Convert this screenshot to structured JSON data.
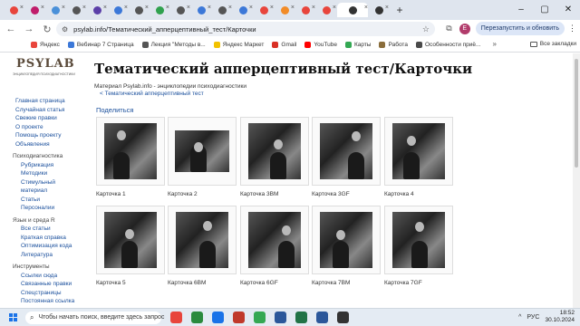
{
  "browser": {
    "tabs": [
      {
        "color": "#e8453c"
      },
      {
        "color": "#c01d6b"
      },
      {
        "color": "#4a90d9"
      },
      {
        "color": "#555555"
      },
      {
        "color": "#5b3fa8"
      },
      {
        "color": "#3c78d8"
      },
      {
        "color": "#555555"
      },
      {
        "color": "#30a14e"
      },
      {
        "color": "#555555"
      },
      {
        "color": "#3c78d8"
      },
      {
        "color": "#555555"
      },
      {
        "color": "#3c78d8"
      },
      {
        "color": "#e8453c"
      },
      {
        "color": "#f28c28"
      },
      {
        "color": "#e8453c"
      },
      {
        "color": "#e8453c"
      },
      {
        "color": "#333333",
        "active": true
      },
      {
        "color": "#333333"
      }
    ],
    "new_tab_glyph": "+",
    "window_controls": [
      "–",
      "▢",
      "✕"
    ],
    "nav": {
      "back": "←",
      "forward": "→",
      "reload": "↻"
    },
    "url": "psylab.info/Тематический_апперцептивный_тест/Карточки",
    "star_glyph": "☆",
    "avatar_letter": "E",
    "update_label": "Перезапустить и обновить",
    "menu_glyph": "⋮"
  },
  "bookmarks": {
    "items": [
      {
        "label": "Яндекс",
        "color": "#e8453c"
      },
      {
        "label": "Вебинар 7 Страница",
        "color": "#3c78d8"
      },
      {
        "label": "Лекция \"Методы в...",
        "color": "#555555"
      },
      {
        "label": "Яндекс Маркет",
        "color": "#f2c200"
      },
      {
        "label": "Gmail",
        "color": "#d93025"
      },
      {
        "label": "YouTube",
        "color": "#ff0000"
      },
      {
        "label": "Карты",
        "color": "#34a853"
      },
      {
        "label": "Работа",
        "color": "#8a6d3b"
      },
      {
        "label": "Особенности приё...",
        "color": "#4a4a4a"
      }
    ],
    "more_glyph": "»",
    "all_label": "Все закладки"
  },
  "site": {
    "logo_word": "PSYLAB",
    "logo_tagline": "ЭНЦИКЛОПЕДИЯ ПСИХОДИАГНОСТИКИ",
    "sidebar": [
      {
        "type": "link",
        "label": "Главная страница"
      },
      {
        "type": "link",
        "label": "Случайная статья"
      },
      {
        "type": "link",
        "label": "Свежие правки"
      },
      {
        "type": "link",
        "label": "О проекте"
      },
      {
        "type": "link",
        "label": "Помощь проекту"
      },
      {
        "type": "link",
        "label": "Объявления"
      },
      {
        "type": "header",
        "label": "Психодиагностика"
      },
      {
        "type": "sub",
        "label": "Рубрикация"
      },
      {
        "type": "sub",
        "label": "Методики"
      },
      {
        "type": "sub",
        "label": "Стимульный"
      },
      {
        "type": "sub",
        "label": "материал"
      },
      {
        "type": "sub",
        "label": "Статьи"
      },
      {
        "type": "sub",
        "label": "Персоналии"
      },
      {
        "type": "header",
        "label": "Язык и среда R"
      },
      {
        "type": "sub",
        "label": "Все статьи"
      },
      {
        "type": "sub",
        "label": "Краткая справка"
      },
      {
        "type": "sub",
        "label": "Оптимизация кода"
      },
      {
        "type": "sub",
        "label": "Литература"
      },
      {
        "type": "header",
        "label": "Инструменты"
      },
      {
        "type": "sub",
        "label": "Ссылки сюда"
      },
      {
        "type": "sub",
        "label": "Связанные правки"
      },
      {
        "type": "sub",
        "label": "Спецстраницы"
      },
      {
        "type": "sub",
        "label": "Постоянная ссылка"
      }
    ],
    "title": "Тематический апперцептивный тест/Карточки",
    "subtitle": "Материал Psylab.info - энциклопедии психодиагностики",
    "back_link": "< Тематический апперцептивный тест",
    "share_link": "Поделиться",
    "cards": [
      "Карточка 1",
      "Карточка 2",
      "Карточка 3BM",
      "Карточка 3GF",
      "Карточка 4",
      "Карточка 5",
      "Карточка 6BM",
      "Карточка 6GF",
      "Карточка 7BM",
      "Карточка 7GF"
    ]
  },
  "taskbar": {
    "search_placeholder": "Чтобы начать поиск, введите здесь запрос",
    "apps": [
      {
        "color": "#e8453c"
      },
      {
        "color": "#2b8a3e"
      },
      {
        "color": "#1a73e8"
      },
      {
        "color": "#c0392b"
      },
      {
        "color": "#34a853"
      },
      {
        "color": "#2b579a"
      },
      {
        "color": "#217346"
      },
      {
        "color": "#2b579a"
      },
      {
        "color": "#333333"
      }
    ],
    "lang": "РУС",
    "time": "18:52",
    "date": "30.10.2024"
  }
}
